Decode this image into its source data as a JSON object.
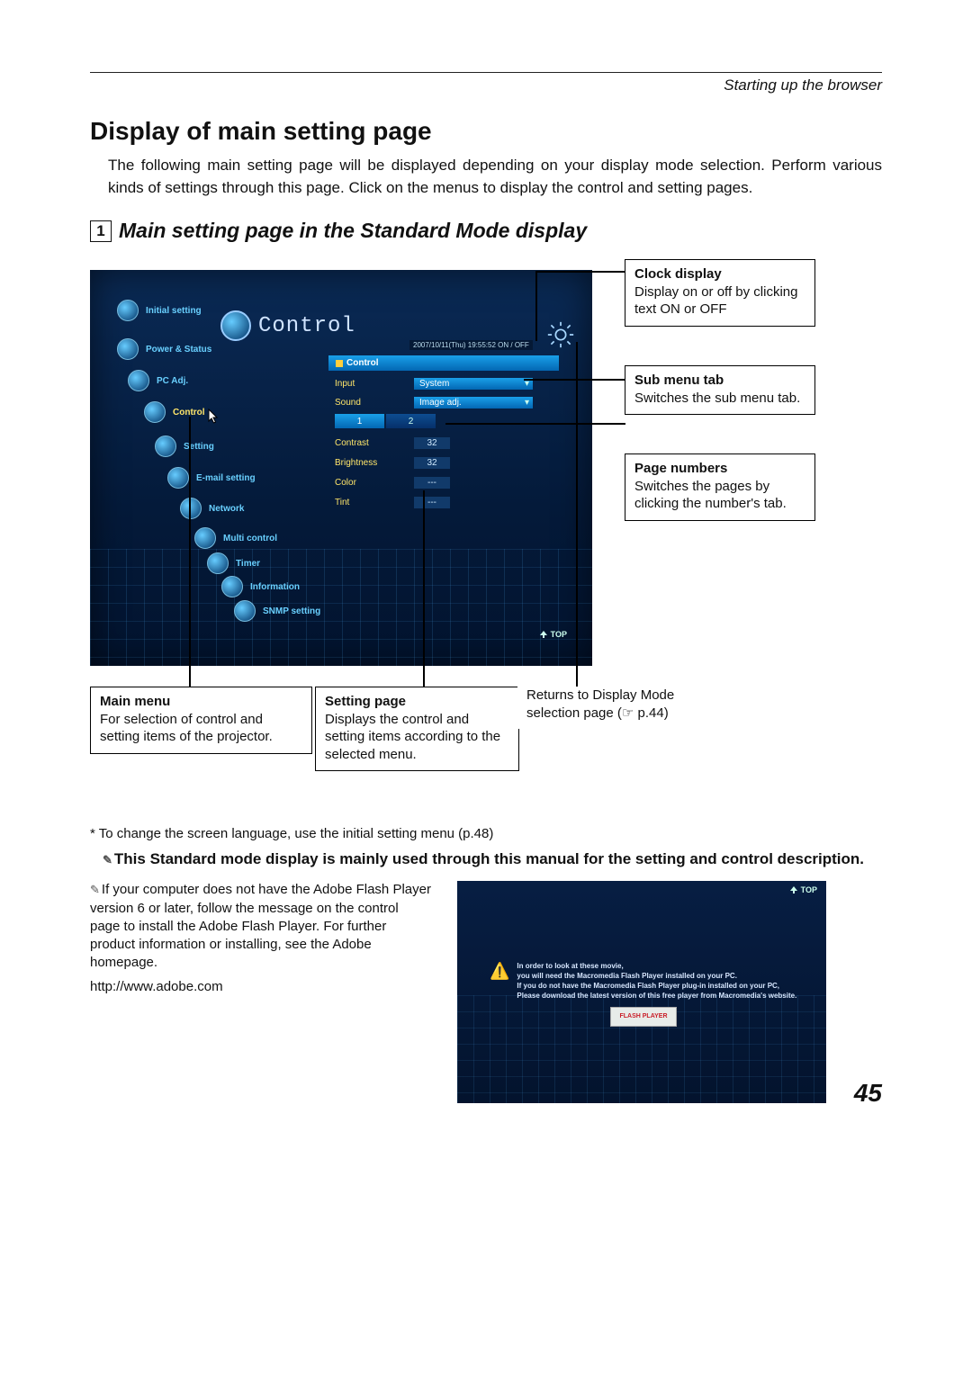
{
  "header": {
    "section": "Starting up the browser"
  },
  "title": "Display of main setting page",
  "intro": "The following main setting page will be displayed depending on your display mode selection. Perform various kinds of settings through this page. Click on the menus to display the control and setting pages.",
  "subhead": {
    "num": "1",
    "text": "Main setting page in the Standard Mode display"
  },
  "screen": {
    "control_title": "Control",
    "clock_line": "2007/10/11(Thu) 19:55:52  ON / OFF",
    "sidebar": [
      "Initial setting",
      "Power & Status",
      "PC Adj.",
      "Control",
      "Setting",
      "E-mail setting",
      "Network",
      "Multi control",
      "Timer",
      "Information",
      "SNMP setting"
    ],
    "submenu_label": "Control",
    "rows": {
      "input": {
        "label": "Input",
        "value": "System"
      },
      "sound": {
        "label": "Sound",
        "value": "Image adj."
      },
      "contrast": {
        "label": "Contrast",
        "value": "32"
      },
      "brightness": {
        "label": "Brightness",
        "value": "32"
      },
      "color": {
        "label": "Color",
        "value": "---"
      },
      "tint": {
        "label": "Tint",
        "value": "---"
      }
    },
    "page_tabs": [
      "1",
      "2"
    ],
    "top_badge": "TOP"
  },
  "callouts": {
    "clock": {
      "title": "Clock display",
      "body": "Display on or off by clicking text ON or OFF"
    },
    "submenu": {
      "title": "Sub menu tab",
      "body": "Switches the sub menu tab."
    },
    "pagenums": {
      "title": "Page numbers",
      "body": "Switches the pages by clicking the number's tab."
    },
    "mainmenu": {
      "title": "Main menu",
      "body": "For selection of  control and setting items of the projector."
    },
    "settingpage": {
      "title": "Setting page",
      "body": "Displays the control and setting items according to the selected menu."
    },
    "returns": "Returns to Display Mode selection page (☞ p.44)"
  },
  "footnote_lang": "* To change the screen language, use the initial setting menu (p.48)",
  "bold_note": "This Standard mode display is mainly used through this manual for the setting and control description.",
  "flash_note": "If your computer does not have the Adobe Flash Player version 6 or later, follow the message on the control page to install the Adobe Flash Player. For further product information or installing, see the Adobe homepage.",
  "adobe_url": "http://www.adobe.com",
  "flashshot": {
    "top": "TOP",
    "msg": "In order to look at these movie,\nyou will need the Macromedia Flash Player installed on your PC.\nIf you do not have the Macromedia Flash Player plug-in installed on your PC,\nPlease download the latest version of this free player from Macromedia's website.",
    "btn": "FLASH PLAYER"
  },
  "page_number": "45"
}
